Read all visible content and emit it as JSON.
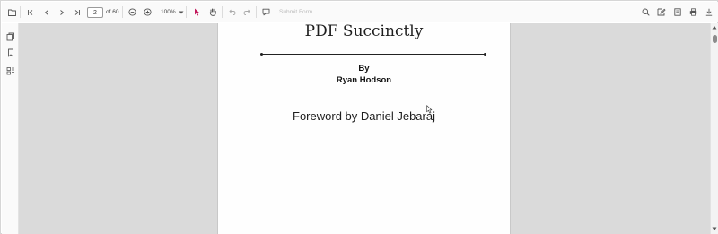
{
  "toolbar": {
    "open_icon": "folder-open-icon",
    "first_page_icon": "first-page-icon",
    "previous_page_icon": "chevron-left-icon",
    "next_page_icon": "chevron-right-icon",
    "last_page_icon": "last-page-icon",
    "current_page": "2",
    "page_count_label": "of 60",
    "zoom_out_icon": "zoom-out-icon",
    "zoom_in_icon": "zoom-in-icon",
    "zoom_level": "100%",
    "zoom_dropdown_icon": "caret-down-icon",
    "selection_tool_icon": "pointer-icon",
    "pan_tool_icon": "hand-icon",
    "undo_icon": "undo-icon",
    "redo_icon": "redo-icon",
    "comment_icon": "comment-icon",
    "submit_form_label": "Submit Form",
    "search_icon": "search-icon",
    "annotation_edit_icon": "edit-annotation-icon",
    "form_designer_icon": "form-icon",
    "print_icon": "print-icon",
    "download_icon": "download-icon"
  },
  "sidebar": {
    "items": [
      {
        "icon": "page-thumbnails-icon"
      },
      {
        "icon": "bookmark-icon"
      },
      {
        "icon": "organize-pages-icon"
      }
    ]
  },
  "document": {
    "title": "PDF Succinctly",
    "by": "By",
    "author": "Ryan Hodson",
    "foreword": "Foreword by Daniel Jebaraj"
  },
  "colors": {
    "toolbar_bg": "#fafafa",
    "viewer_bg": "#dadada",
    "page_bg": "#fefefe",
    "selection_accent": "#c2185b",
    "icon_color": "#555555"
  }
}
